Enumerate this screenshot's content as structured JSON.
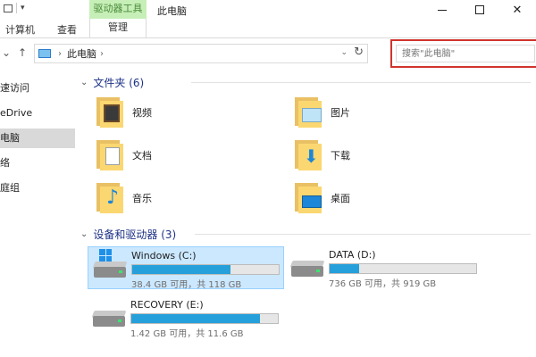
{
  "titlebar": {
    "context_tab": "驱动器工具",
    "window_title": "此电脑",
    "qa_dropdown": "▾"
  },
  "tabs": [
    "计算机",
    "查看",
    "管理"
  ],
  "address": {
    "crumb": "此电脑",
    "search_placeholder": "搜索\"此电脑\""
  },
  "nav": {
    "items": [
      "速访问",
      "eDrive",
      "电脑",
      "络",
      "庭组"
    ],
    "selected_index": 2
  },
  "folders": {
    "header": "文件夹 (6)",
    "items": [
      {
        "name": "视频",
        "icon": "video-folder-icon"
      },
      {
        "name": "图片",
        "icon": "pictures-folder-icon"
      },
      {
        "name": "文档",
        "icon": "documents-folder-icon"
      },
      {
        "name": "下载",
        "icon": "downloads-folder-icon"
      },
      {
        "name": "音乐",
        "icon": "music-folder-icon"
      },
      {
        "name": "桌面",
        "icon": "desktop-folder-icon"
      }
    ]
  },
  "drives": {
    "header": "设备和驱动器 (3)",
    "items": [
      {
        "name": "Windows (C:)",
        "capacity": "38.4 GB 可用，共 118 GB",
        "used_fraction": 0.67,
        "selected": true
      },
      {
        "name": "DATA (D:)",
        "capacity": "736 GB 可用，共 919 GB",
        "used_fraction": 0.2,
        "selected": false
      },
      {
        "name": "RECOVERY (E:)",
        "capacity": "1.42 GB 可用，共 11.6 GB",
        "used_fraction": 0.88,
        "selected": false
      }
    ]
  },
  "colors": {
    "context_tab_bg": "#c6efb7",
    "search_highlight": "#d0342c",
    "drive_bar_fill": "#26a0da",
    "group_header": "#1e3287"
  }
}
